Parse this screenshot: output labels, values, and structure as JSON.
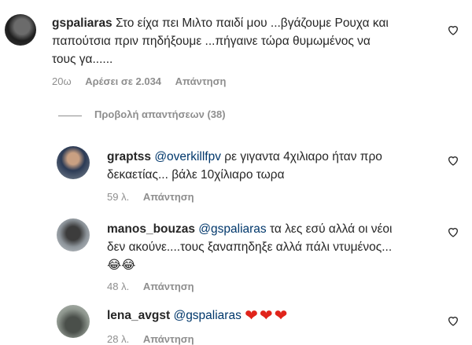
{
  "comments": [
    {
      "username": "gspaliaras",
      "text_line1": "Στο είχα πει Μιλτο παιδί μου ...βγάζουμε Ρουχα και",
      "text_line2": "παπούτσια πριν πηδήξουμε ...πήγαινε τώρα θυμωμένος να",
      "text_line3": "τους γα......",
      "time": "20ω",
      "likes": "Αρέσει σε 2.034",
      "reply": "Απάντηση"
    }
  ],
  "view_replies": "Προβολή απαντήσεων (38)",
  "replies": [
    {
      "username": "graptss",
      "mention": "@overkillfpv",
      "text_line1": "ρε γιγαντα 4χιλιαρο ήταν προ",
      "text_line2": "δεκαετίας... βάλε 10χίλιαρο τωρα",
      "time": "59 λ.",
      "reply": "Απάντηση"
    },
    {
      "username": "manos_bouzas",
      "mention": "@gspaliaras",
      "text_line1": "τα λες εσύ αλλά οι νέοι",
      "text_line2": "δεν ακούνε....τους ξαναπηδηξε αλλά πάλι ντυμένος...",
      "text_line3": "😂😂",
      "time": "48 λ.",
      "reply": "Απάντηση"
    },
    {
      "username": "lena_avgst",
      "mention": "@gspaliaras",
      "text_line1": "❤❤❤",
      "time": "28 λ.",
      "reply": "Απάντηση"
    }
  ],
  "icons": {
    "like": "heart-outline-icon"
  }
}
